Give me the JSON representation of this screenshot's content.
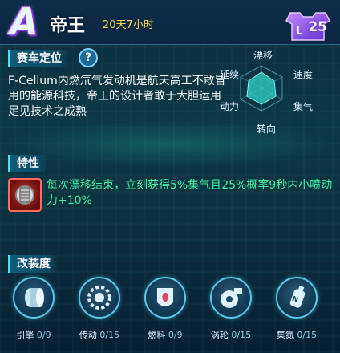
{
  "header": {
    "grade": "A",
    "car_name": "帝王",
    "duration": "20天7小时",
    "level": "25"
  },
  "positioning": {
    "title": "赛车定位",
    "help_symbol": "?",
    "description": "F-Cellum内燃氘气发动机是航天高工不敢冒用的能源科技，帝王的设计者敢于大胆运用足见技术之成熟"
  },
  "stats": {
    "labels": {
      "drift": "漂移",
      "speed": "速度",
      "boost": "集气",
      "steering": "转向",
      "power": "动力",
      "endurance": "延续"
    }
  },
  "trait": {
    "title": "特性",
    "icon": "engine-part-icon",
    "text": "每次漂移结束，立刻获得5%集气且25%概率9秒内小喷动力+10%"
  },
  "modification": {
    "title": "改装度",
    "items": [
      {
        "name": "引擎",
        "value": "0/9",
        "icon": "engine-icon"
      },
      {
        "name": "传动",
        "value": "0/15",
        "icon": "transmission-icon"
      },
      {
        "name": "燃料",
        "value": "0/9",
        "icon": "fuel-icon"
      },
      {
        "name": "涡轮",
        "value": "0/15",
        "icon": "turbo-icon"
      },
      {
        "name": "集氮",
        "value": "0/15",
        "icon": "nitrogen-icon"
      }
    ]
  },
  "colors": {
    "accent": "#3fe3ff",
    "trait_text": "#3ff0a0",
    "duration": "#f7d54a",
    "radar_fill": "#2fd0c8"
  }
}
